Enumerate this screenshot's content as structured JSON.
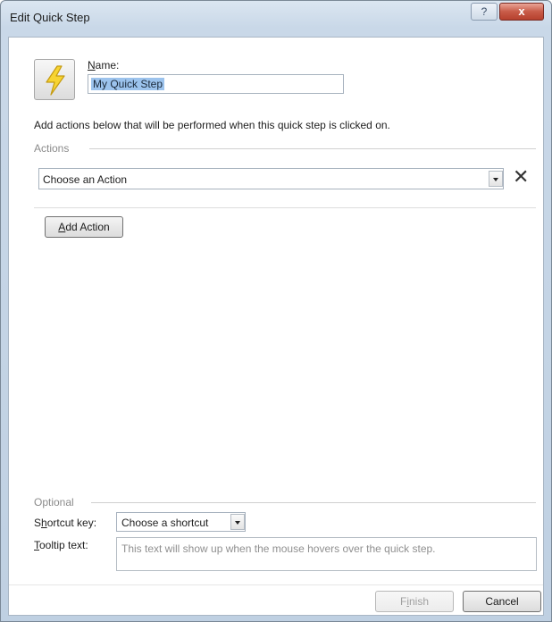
{
  "window": {
    "title": "Edit Quick Step",
    "help_label": "?",
    "close_label": "x"
  },
  "name": {
    "label_prefix": "",
    "label_accel": "N",
    "label_rest": "ame:",
    "value": "My Quick Step"
  },
  "instructions": "Add actions below that will be performed when this quick step is clicked on.",
  "actions": {
    "section_label": "Actions",
    "select_value": "Choose an Action",
    "remove_label": "✕",
    "add_button": {
      "accel": "A",
      "rest": "dd Action"
    }
  },
  "optional": {
    "section_label": "Optional",
    "shortcut": {
      "label_prefix": "S",
      "label_accel": "h",
      "label_rest": "ortcut key:",
      "value": "Choose a shortcut"
    },
    "tooltip": {
      "label_accel": "T",
      "label_rest": "ooltip text:",
      "placeholder": "This text will show up when the mouse hovers over the quick step."
    }
  },
  "footer": {
    "finish": {
      "prefix": "F",
      "accel": "i",
      "rest": "nish"
    },
    "cancel": "Cancel"
  },
  "colors": {
    "icon_fill": "#f7d431",
    "icon_stroke": "#c49a12",
    "selection": "#9cc3ed",
    "close_button": "#c85b48"
  },
  "icons": {
    "quick_step": "lightning-bolt-icon",
    "remove": "close-icon",
    "dropdown": "chevron-down-icon"
  }
}
